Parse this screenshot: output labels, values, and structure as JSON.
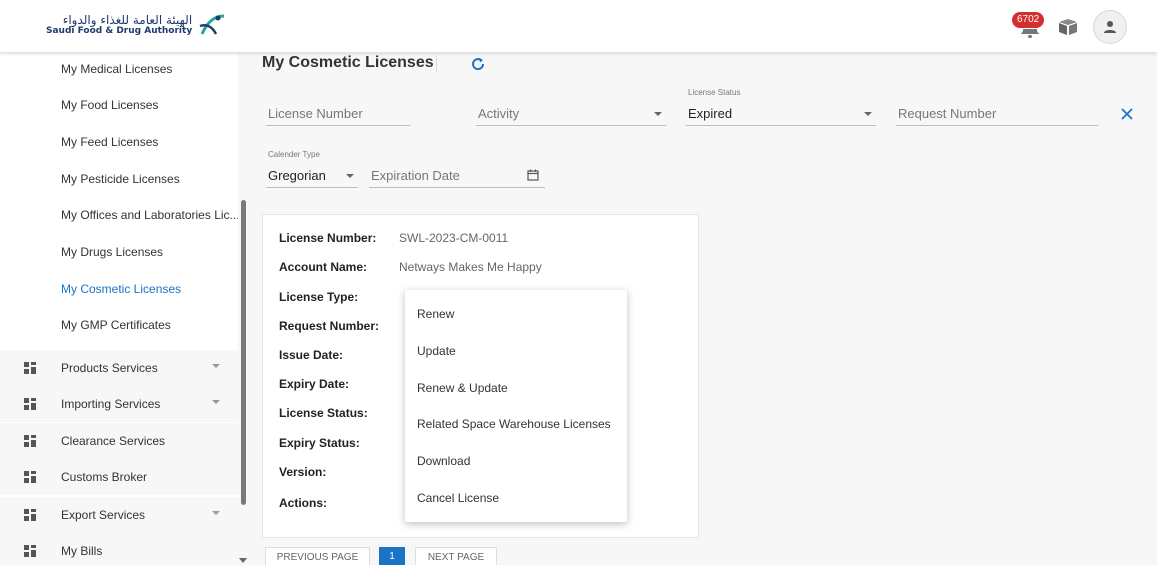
{
  "header": {
    "logo_ar": "الهيئة العامة للغذاء والدواء",
    "logo_en": "Saudi Food & Drug Authority",
    "notification_count": "6702"
  },
  "sidebar": {
    "sub_items": [
      {
        "label": "My Medical Licenses"
      },
      {
        "label": "My Food Licenses"
      },
      {
        "label": "My Feed Licenses"
      },
      {
        "label": "My Pesticide Licenses"
      },
      {
        "label": "My Offices and Laboratories Lic..."
      },
      {
        "label": "My Drugs Licenses"
      },
      {
        "label": "My Cosmetic Licenses"
      },
      {
        "label": "My GMP Certificates"
      }
    ],
    "main_items": [
      {
        "label": "Products Services"
      },
      {
        "label": "Importing Services"
      },
      {
        "label": "Clearance Services"
      },
      {
        "label": "Customs Broker"
      },
      {
        "label": "Export Services"
      },
      {
        "label": "My Bills"
      }
    ]
  },
  "main": {
    "title": "My Cosmetic Licenses",
    "filters": {
      "license_number_placeholder": "License Number",
      "activity_placeholder": "Activity",
      "license_status_label": "License Status",
      "license_status_value": "Expired",
      "request_number_placeholder": "Request Number",
      "calendar_type_label": "Calender Type",
      "calendar_type_value": "Gregorian",
      "expiration_date_placeholder": "Expiration Date"
    },
    "card": {
      "rows": [
        {
          "key": "License Number:",
          "value": "SWL-2023-CM-0011"
        },
        {
          "key": "Account Name:",
          "value": "Netways Makes Me Happy"
        },
        {
          "key": "License Type:",
          "value": ""
        },
        {
          "key": "Request Number:",
          "value": ""
        },
        {
          "key": "Issue Date:",
          "value": ""
        },
        {
          "key": "Expiry Date:",
          "value": ""
        },
        {
          "key": "License Status:",
          "value": ""
        },
        {
          "key": "Expiry Status:",
          "value": ""
        },
        {
          "key": "Version:",
          "value": ""
        },
        {
          "key": "Actions:",
          "value": ""
        }
      ]
    },
    "actions_menu": [
      {
        "label": "Renew"
      },
      {
        "label": "Update"
      },
      {
        "label": "Renew & Update"
      },
      {
        "label": "Related Space Warehouse Licenses"
      },
      {
        "label": "Download"
      },
      {
        "label": "Cancel License"
      }
    ],
    "pagination": {
      "previous": "PREVIOUS PAGE",
      "current": "1",
      "next": "NEXT PAGE"
    }
  },
  "colors": {
    "accent": "#1a73c8",
    "badge": "#d32f2f"
  }
}
